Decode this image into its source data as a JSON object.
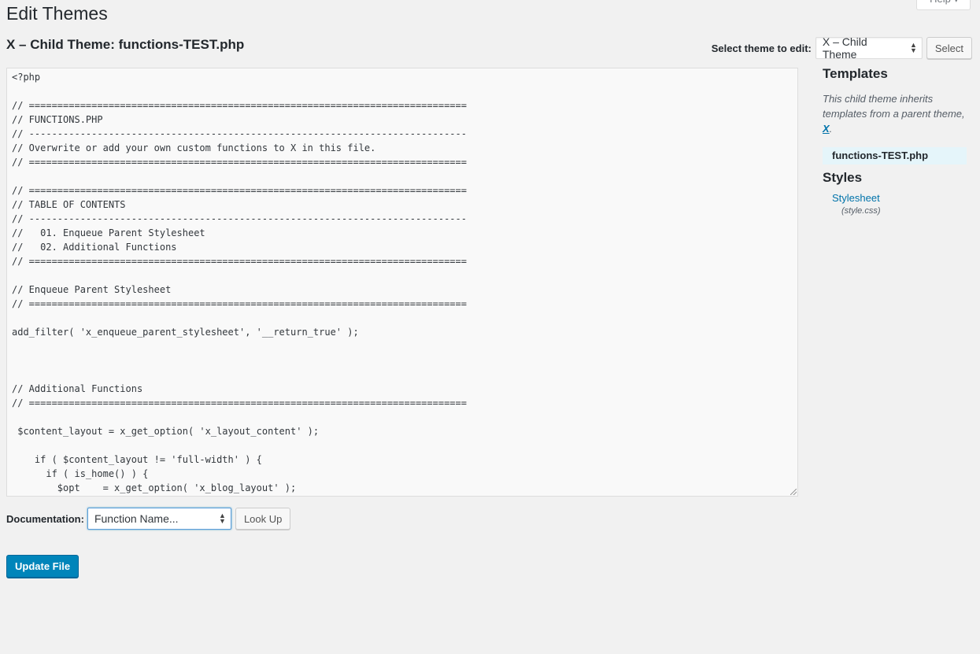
{
  "header": {
    "page_title": "Edit Themes",
    "help_label": "Help ▾"
  },
  "editor_header": {
    "file_title": "X – Child Theme: functions-TEST.php",
    "select_theme_label": "Select theme to edit:",
    "selected_theme": "X – Child Theme",
    "select_button": "Select"
  },
  "editor": {
    "lines": [
      "<?php",
      "",
      "// =============================================================================",
      "// FUNCTIONS.PHP",
      "// -----------------------------------------------------------------------------",
      "// Overwrite or add your own custom functions to X in this file.",
      "// =============================================================================",
      "",
      "// =============================================================================",
      "// TABLE OF CONTENTS",
      "// -----------------------------------------------------------------------------",
      "//   01. Enqueue Parent Stylesheet",
      "//   02. Additional Functions",
      "// =============================================================================",
      "",
      "// Enqueue Parent Stylesheet",
      "// =============================================================================",
      "",
      "add_filter( 'x_enqueue_parent_stylesheet', '__return_true' );",
      "",
      "",
      "",
      "// Additional Functions",
      "// =============================================================================",
      "",
      " $content_layout = x_get_option( 'x_layout_content' );",
      "",
      "    if ( $content_layout != 'full-width' ) {",
      "      if ( is_home() ) {",
      "        $opt    = x_get_option( 'x_blog_layout' );"
    ]
  },
  "sidebar": {
    "templates_heading": "Templates",
    "inherit_text": "This child theme inherits templates from a parent theme, ",
    "parent_theme_link": "X",
    "inherit_suffix": ".",
    "template_files": [
      "functions-TEST.php"
    ],
    "styles_heading": "Styles",
    "stylesheet_label": "Stylesheet",
    "stylesheet_file": "(style.css)"
  },
  "documentation": {
    "label": "Documentation:",
    "selected": "Function Name...",
    "lookup_button": "Look Up"
  },
  "footer": {
    "update_button": "Update File"
  },
  "colors": {
    "accent": "#0085ba",
    "link": "#0073aa",
    "background": "#f1f1f1",
    "highlight": "#e5f5fa"
  }
}
